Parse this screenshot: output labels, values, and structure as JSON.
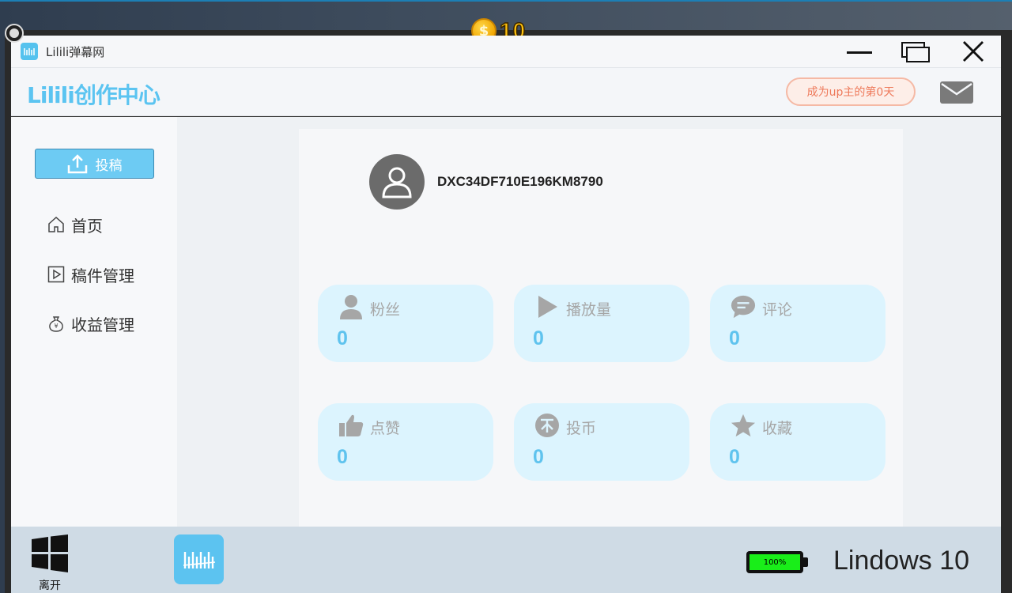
{
  "coins": {
    "icon": "coin-icon",
    "glyph": "$",
    "count": "10"
  },
  "window": {
    "title": "Lilili弹幕网",
    "controls": [
      "minimize-icon",
      "maximize-icon",
      "close-icon"
    ]
  },
  "header": {
    "brand": "Lilili创作中心",
    "up_badge": "成为up主的第0天",
    "mail_icon": "mail-icon"
  },
  "sidebar": {
    "upload_label": "投稿",
    "items": [
      {
        "label": "首页",
        "icon": "home-icon"
      },
      {
        "label": "稿件管理",
        "icon": "video-icon"
      },
      {
        "label": "收益管理",
        "icon": "money-bag-icon"
      }
    ]
  },
  "profile": {
    "username": "DXC34DF710E196KM8790"
  },
  "stats": [
    {
      "label": "粉丝",
      "value": "0",
      "icon": "fans-icon"
    },
    {
      "label": "播放量",
      "value": "0",
      "icon": "play-icon"
    },
    {
      "label": "评论",
      "value": "0",
      "icon": "comment-icon"
    },
    {
      "label": "点赞",
      "value": "0",
      "icon": "like-icon"
    },
    {
      "label": "投币",
      "value": "0",
      "icon": "coin-icon"
    },
    {
      "label": "收藏",
      "value": "0",
      "icon": "star-icon"
    }
  ],
  "taskbar": {
    "start_label": "离开",
    "battery_text": "100%",
    "battery_level": 1.0,
    "os_name": "Lindows 10"
  },
  "colors": {
    "accent": "#5bc4f1",
    "card_bg": "#dcf4fe",
    "badge_text": "#ee7a5b",
    "battery": "#19ee19"
  }
}
